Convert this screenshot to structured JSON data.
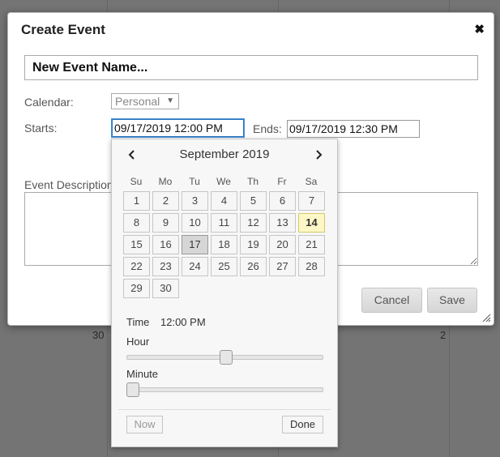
{
  "background": {
    "day_numbers": [
      "30",
      "2"
    ]
  },
  "dialog": {
    "title": "Create Event",
    "close_icon": "close-icon",
    "event_name_placeholder": "New Event Name...",
    "calendar_label": "Calendar:",
    "calendar_value": "Personal",
    "starts_label": "Starts:",
    "starts_value": "09/17/2019 12:00 PM",
    "ends_label": "Ends:",
    "ends_value": "09/17/2019 12:30 PM",
    "description_label": "Event Description",
    "cancel_label": "Cancel",
    "save_label": "Save"
  },
  "datepicker": {
    "month_label": "September 2019",
    "prev_icon": "chevron-left-icon",
    "next_icon": "chevron-right-icon",
    "weekdays": [
      "Su",
      "Mo",
      "Tu",
      "We",
      "Th",
      "Fr",
      "Sa"
    ],
    "days": [
      "1",
      "2",
      "3",
      "4",
      "5",
      "6",
      "7",
      "8",
      "9",
      "10",
      "11",
      "12",
      "13",
      "14",
      "15",
      "16",
      "17",
      "18",
      "19",
      "20",
      "21",
      "22",
      "23",
      "24",
      "25",
      "26",
      "27",
      "28",
      "29",
      "30"
    ],
    "today": "14",
    "selected": "17",
    "time_label": "Time",
    "time_value": "12:00 PM",
    "hour_label": "Hour",
    "hour_fraction": 0.5,
    "minute_label": "Minute",
    "minute_fraction": 0.0,
    "now_label": "Now",
    "done_label": "Done"
  },
  "colors": {
    "today_highlight": "#fcf7c6",
    "selected_day": "#d6d6d6",
    "focus_border": "#2a77c0"
  }
}
